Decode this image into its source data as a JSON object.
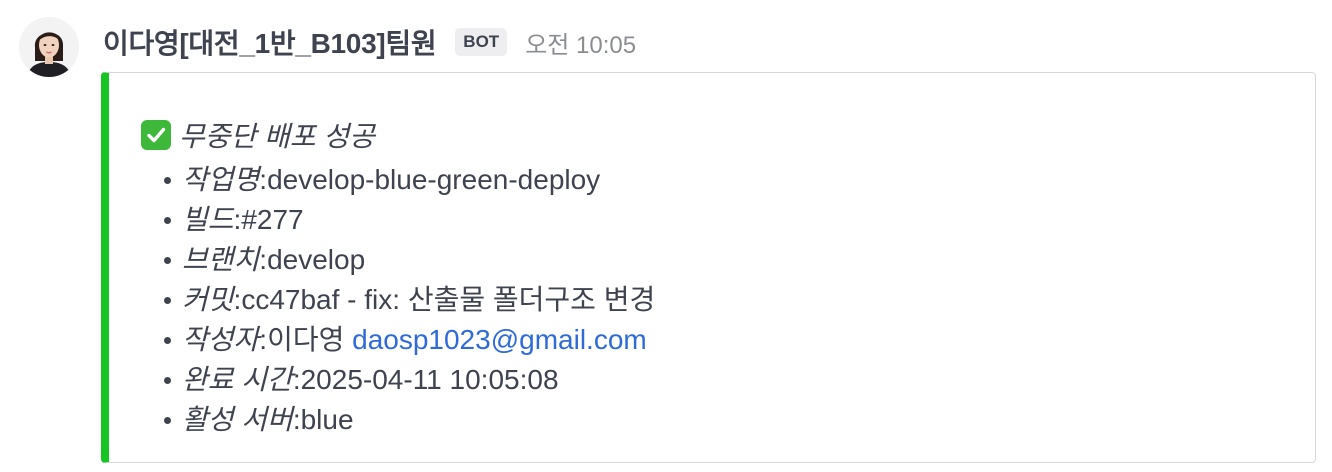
{
  "post": {
    "username": "이다영[대전_1반_B103]팀원",
    "badge": "BOT",
    "time": "오전 10:05"
  },
  "attachment": {
    "accent_color": "#16c423",
    "icon": "white-check-mark-icon",
    "title": "무중단 배포 성공",
    "fields": [
      {
        "label": "작업명",
        "separator": ": ",
        "value": "develop-blue-green-deploy"
      },
      {
        "label": "빌드",
        "separator": ": ",
        "value": "#277"
      },
      {
        "label": "브랜치",
        "separator": ": ",
        "value": "develop"
      },
      {
        "label": "커밋",
        "separator": ": ",
        "value": "cc47baf - fix: 산출물 폴더구조 변경"
      },
      {
        "label": "작성자",
        "separator": ": ",
        "value": "이다영 ",
        "link": "daosp1023@gmail.com"
      },
      {
        "label": "완료 시간",
        "separator": ": ",
        "value": "2025-04-11 10:05:08"
      },
      {
        "label": "활성 서버",
        "separator": ": ",
        "value": "blue"
      }
    ]
  }
}
